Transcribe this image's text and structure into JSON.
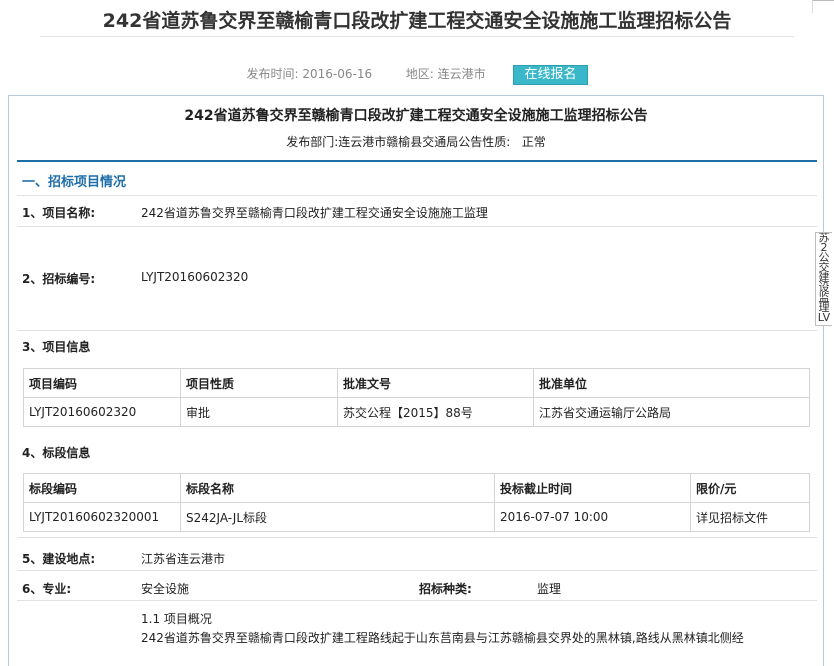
{
  "page_title": "242省道苏鲁交界至赣榆青口段改扩建工程交通安全设施施工监理招标公告",
  "meta": {
    "publish_label": "发布时间:",
    "publish_date": "2016-06-16",
    "region_label": "地区:",
    "region": "连云港市",
    "signup_button": "在线报名"
  },
  "notice": {
    "title": "242省道苏鲁交界至赣榆青口段改扩建工程交通安全设施施工监理招标公告",
    "dept_label": "发布部门:",
    "dept": "连云港市赣榆县交通局",
    "nature_label": "公告性质:",
    "nature": "正常"
  },
  "section1": {
    "heading": "一、招标项目情况",
    "project_name_label": "1、项目名称:",
    "project_name": "242省道苏鲁交界至赣榆青口段改扩建工程交通安全设施施工监理",
    "bid_no_label": "2、招标编号:",
    "bid_no": "LYJT20160602320",
    "project_info_label": "3、项目信息",
    "project_table": {
      "headers": [
        "项目编码",
        "项目性质",
        "批准文号",
        "批准单位"
      ],
      "row": [
        "LYJT20160602320",
        "审批",
        "苏交公程【2015】88号",
        "江苏省交通运输厅公路局"
      ]
    },
    "section_info_label": "4、标段信息",
    "section_table": {
      "headers": [
        "标段编码",
        "标段名称",
        "投标截止时间",
        "限价/元"
      ],
      "row": [
        "LYJT20160602320001",
        "S242JA-JL标段",
        "2016-07-07 10:00",
        "详见招标文件"
      ]
    },
    "location_label": "5、建设地点:",
    "location": "江苏省连云港市",
    "specialty_label": "6、专业:",
    "specialty": "安全设施",
    "bid_type_label": "招标种类:",
    "bid_type": "监理",
    "overview_heading": "1.1 项目概况",
    "overview_text": "242省道苏鲁交界至赣榆青口段改扩建工程路线起于山东莒南县与江苏赣榆县交界处的黑林镇,路线从黑林镇北侧经"
  },
  "sidebar_text": "苏2公交建设监理LV"
}
